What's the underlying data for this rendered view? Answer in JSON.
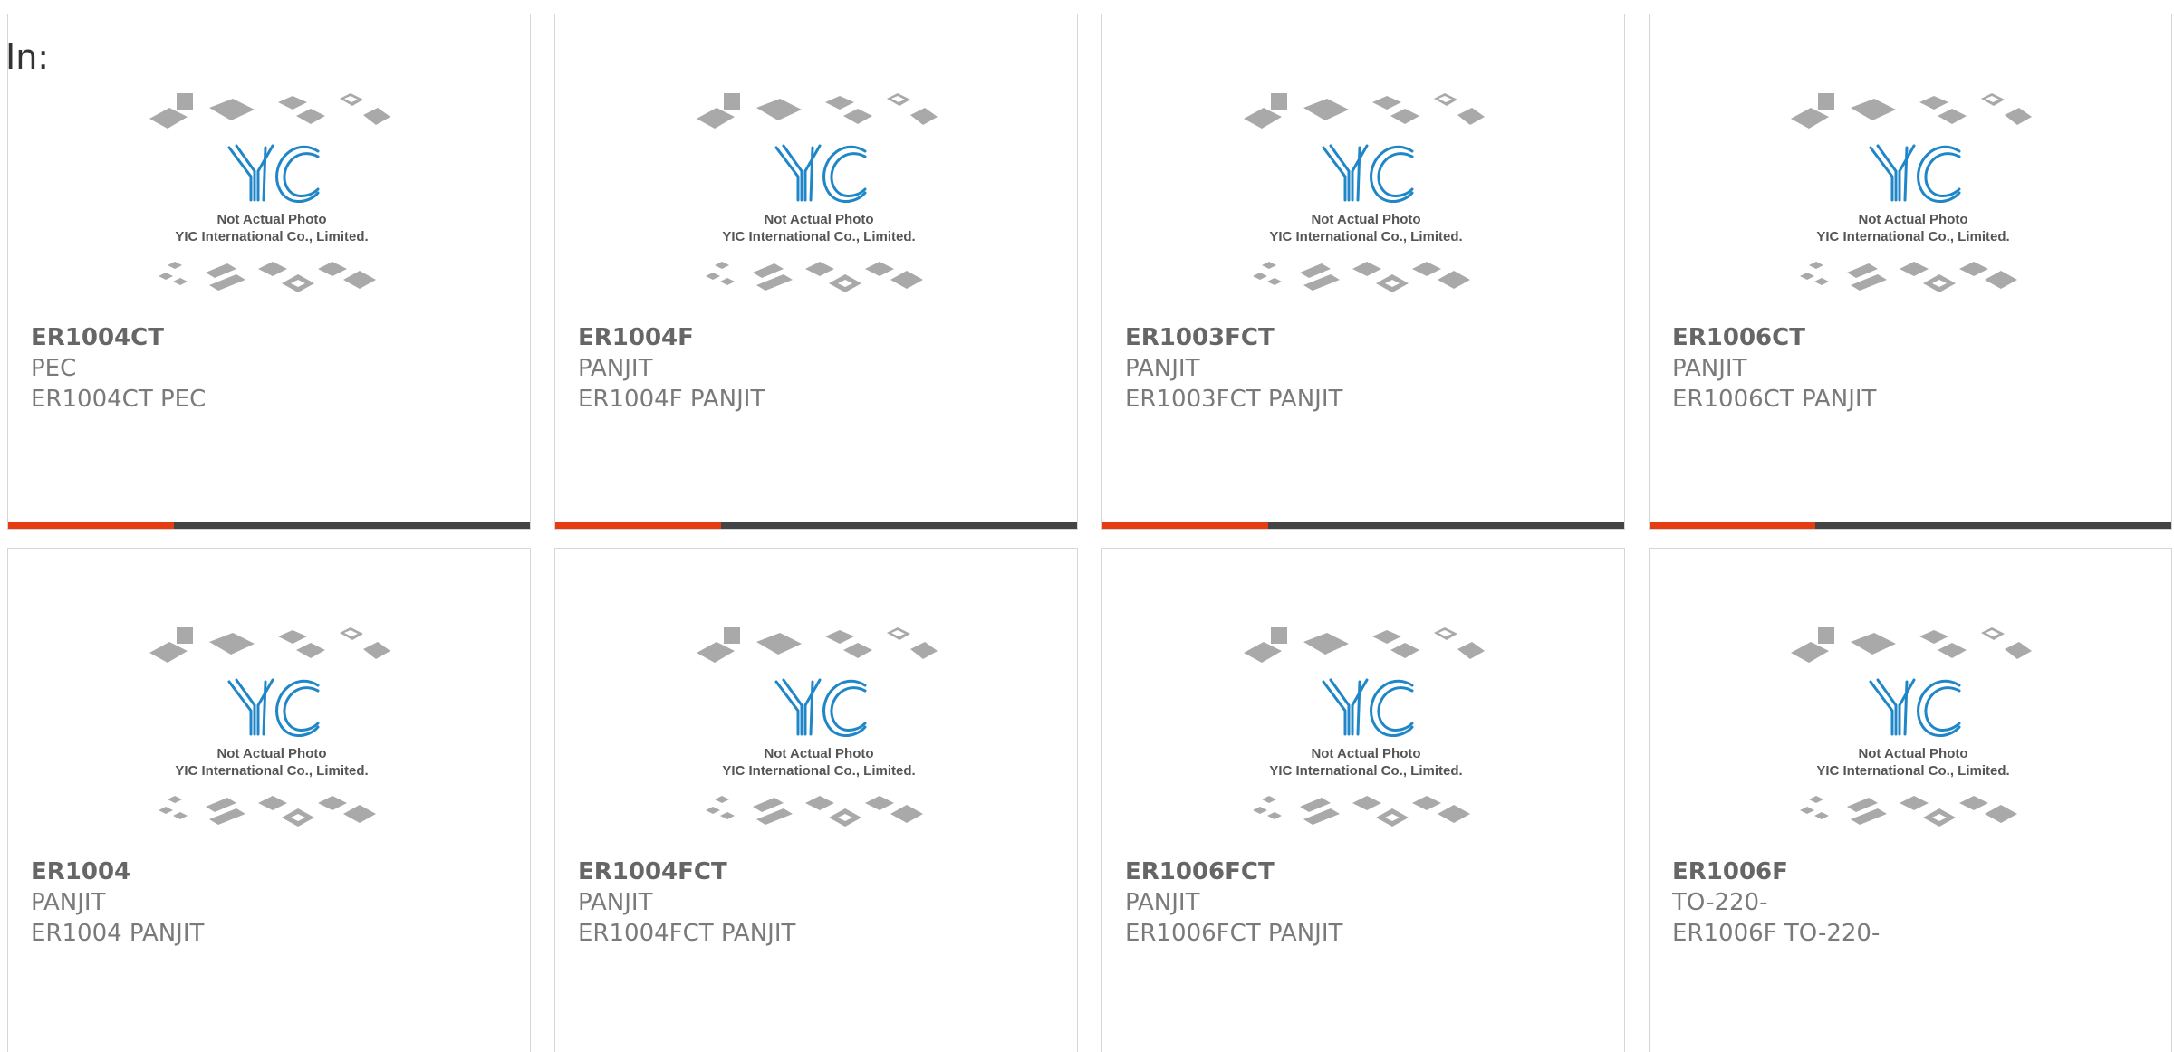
{
  "header": {
    "label": "In:"
  },
  "placeholder": {
    "line1": "Not Actual Photo",
    "line2": "YIC International Co., Limited."
  },
  "colors": {
    "accent": "#e63c12",
    "bar": "#444444",
    "logo": "#1f86c8",
    "chips": "#a9a9a9"
  },
  "products": [
    {
      "part": "ER1004CT",
      "brand": "PEC",
      "desc": "ER1004CT PEC"
    },
    {
      "part": "ER1004F",
      "brand": "PANJIT",
      "desc": "ER1004F PANJIT"
    },
    {
      "part": "ER1003FCT",
      "brand": "PANJIT",
      "desc": "ER1003FCT PANJIT"
    },
    {
      "part": "ER1006CT",
      "brand": "PANJIT",
      "desc": "ER1006CT PANJIT"
    },
    {
      "part": "ER1004",
      "brand": "PANJIT",
      "desc": "ER1004 PANJIT"
    },
    {
      "part": "ER1004FCT",
      "brand": "PANJIT",
      "desc": "ER1004FCT PANJIT"
    },
    {
      "part": "ER1006FCT",
      "brand": "PANJIT",
      "desc": "ER1006FCT PANJIT"
    },
    {
      "part": "ER1006F",
      "brand": "TO-220-",
      "desc": "ER1006F TO-220-"
    }
  ]
}
